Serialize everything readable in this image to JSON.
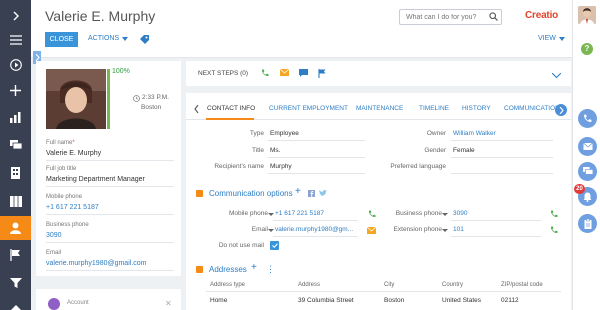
{
  "page": {
    "title": "Valerie E. Murphy",
    "logo_text": "Creatio"
  },
  "header": {
    "search_placeholder": "What can I do for you?",
    "close_label": "CLOSE",
    "actions_label": "ACTIONS",
    "view_label": "VIEW"
  },
  "left_nav": {
    "items": [
      "chevron-right-icon",
      "menu-icon",
      "play-icon",
      "plus-icon",
      "dashboard-icon",
      "chat-icon",
      "building-icon",
      "accounts-icon",
      "contacts-icon",
      "flag-icon",
      "filter-icon",
      "more-icon"
    ]
  },
  "profile": {
    "completeness": "100%",
    "completeness_value": 1.0,
    "local_time": "2:33 P.M.",
    "city": "Boston",
    "fields": [
      {
        "label": "Full name",
        "required": true,
        "value": "Valerie E. Murphy",
        "link": false
      },
      {
        "label": "Full job title",
        "required": false,
        "value": "Marketing Department Manager",
        "link": false
      },
      {
        "label": "Mobile phone",
        "required": false,
        "value": "+1 617 221 5187",
        "link": true
      },
      {
        "label": "Business phone",
        "required": false,
        "value": "3090",
        "link": true
      },
      {
        "label": "Email",
        "required": false,
        "value": "valerie.murphy1980@gmail.com",
        "link": true
      }
    ],
    "account_label": "Account"
  },
  "next_steps": {
    "label": "NEXT STEPS (0)"
  },
  "tabs": [
    "CONTACT INFO",
    "CURRENT EMPLOYMENT",
    "MAINTENANCE",
    "TIMELINE",
    "HISTORY",
    "COMMUNICATIONS"
  ],
  "contact_info": {
    "type_label": "Type",
    "type_value": "Employee",
    "title_label": "Title",
    "title_value": "Ms.",
    "recipient_label": "Recipient's name",
    "recipient_value": "Murphy",
    "owner_label": "Owner",
    "owner_value": "William Walker",
    "gender_label": "Gender",
    "gender_value": "Female",
    "language_label": "Preferred language",
    "language_value": ""
  },
  "communication": {
    "title": "Communication options",
    "mobile_label": "Mobile phone",
    "mobile_value": "+1 617 221 5187",
    "email_label": "Email",
    "email_value": "valerie.murphy1980@gm...",
    "dnu_label": "Do not use mail",
    "business_label": "Business phone",
    "business_value": "3090",
    "extension_label": "Extension phone",
    "extension_value": "101"
  },
  "addresses": {
    "title": "Addresses",
    "columns": [
      "Address type",
      "Address",
      "City",
      "Country",
      "ZIP/postal code"
    ],
    "rows": [
      {
        "type": "Home",
        "address": "39 Columbia Street",
        "city": "Boston",
        "country": "United States",
        "zip": "02112"
      }
    ]
  },
  "right_rail": {
    "badge_count": "20",
    "help_label": "?"
  },
  "colors": {
    "nav_bg": "#384052",
    "accent_orange": "#f58a16",
    "link_blue": "#2d7ec4",
    "button_blue": "#3a94da",
    "success_green": "#79b851",
    "brand_red": "#e0442b"
  }
}
